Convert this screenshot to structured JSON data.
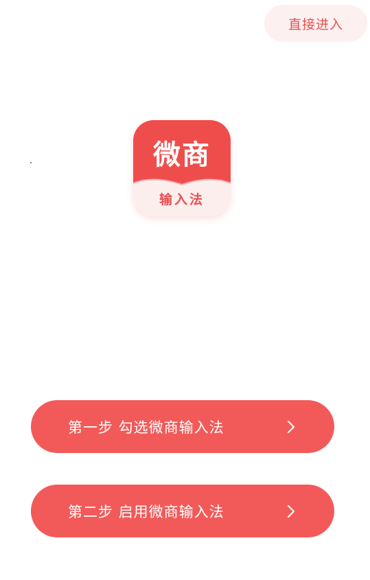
{
  "header": {
    "skip_label": "直接进入"
  },
  "logo": {
    "main_text": "微商",
    "sub_text": "输入法",
    "primary_color": "#ef4d4c",
    "secondary_color": "#fdeeee"
  },
  "steps": [
    {
      "label": "第一步 勾选微商输入法",
      "icon": "chevron-right-icon"
    },
    {
      "label": "第二步 启用微商输入法",
      "icon": "chevron-right-icon"
    }
  ],
  "colors": {
    "accent": "#f25a59",
    "skip_bg": "#fdf0f0",
    "skip_text": "#e8504f",
    "background": "#ffffff"
  }
}
